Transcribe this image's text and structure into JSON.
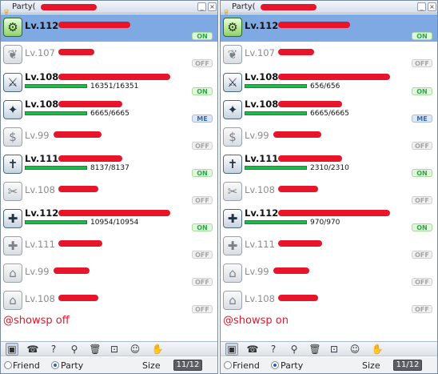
{
  "windows": [
    {
      "title": "Party(",
      "caption": "@showsp off",
      "members": [
        {
          "level": "Lv.112",
          "icon": "mechanic-icon",
          "glyph": "⚙",
          "selected": true,
          "online": true,
          "badge": "ON"
        },
        {
          "level": "Lv.107",
          "icon": "sura-icon",
          "glyph": "❦",
          "online": false,
          "badge": "OFF"
        },
        {
          "level": "Lv.108",
          "icon": "rune-knight-icon",
          "glyph": "⚔",
          "online": true,
          "badge": "ON",
          "hp": "16351/16351",
          "hp_ratio": 1.0
        },
        {
          "level": "Lv.108",
          "icon": "sorcerer-icon",
          "glyph": "✦",
          "online": true,
          "badge": "ME",
          "hp": "6665/6665",
          "hp_ratio": 1.0
        },
        {
          "level": "Lv.99",
          "icon": "merchant-icon",
          "glyph": "$",
          "online": false,
          "badge": "OFF"
        },
        {
          "level": "Lv.111",
          "icon": "arch-bishop-icon",
          "glyph": "✝",
          "online": true,
          "badge": "ON",
          "hp": "8137/8137",
          "hp_ratio": 1.0
        },
        {
          "level": "Lv.108",
          "icon": "guillotine-cross-icon",
          "glyph": "✂",
          "online": false,
          "badge": "OFF"
        },
        {
          "level": "Lv.112",
          "icon": "ranger-icon",
          "glyph": "✚",
          "online": true,
          "badge": "ON",
          "hp": "10954/10954",
          "hp_ratio": 1.0
        },
        {
          "level": "Lv.111",
          "icon": "shadow-chaser-icon",
          "glyph": "✚",
          "online": false,
          "badge": "OFF"
        },
        {
          "level": "Lv.99",
          "icon": "novice-icon",
          "glyph": "⌂",
          "online": false,
          "badge": "OFF"
        },
        {
          "level": "Lv.108",
          "icon": "genetic-icon",
          "glyph": "⌂",
          "online": false,
          "badge": "OFF"
        }
      ],
      "footer": {
        "friend_label": "Friend",
        "party_label": "Party",
        "size_label": "Size",
        "size_value": "11/12"
      }
    },
    {
      "title": "Party(",
      "caption": "@showsp on",
      "members": [
        {
          "level": "Lv.112",
          "icon": "mechanic-icon",
          "glyph": "⚙",
          "selected": true,
          "online": true,
          "badge": "ON"
        },
        {
          "level": "Lv.107",
          "icon": "sura-icon",
          "glyph": "❦",
          "online": false,
          "badge": "OFF"
        },
        {
          "level": "Lv.108",
          "icon": "rune-knight-icon",
          "glyph": "⚔",
          "online": true,
          "badge": "ON",
          "hp": "656/656",
          "hp_ratio": 1.0
        },
        {
          "level": "Lv.108",
          "icon": "sorcerer-icon",
          "glyph": "✦",
          "online": true,
          "badge": "ME",
          "hp": "6665/6665",
          "hp_ratio": 1.0
        },
        {
          "level": "Lv.99",
          "icon": "merchant-icon",
          "glyph": "$",
          "online": false,
          "badge": "OFF"
        },
        {
          "level": "Lv.111",
          "icon": "arch-bishop-icon",
          "glyph": "✝",
          "online": true,
          "badge": "ON",
          "hp": "2310/2310",
          "hp_ratio": 1.0
        },
        {
          "level": "Lv.108",
          "icon": "guillotine-cross-icon",
          "glyph": "✂",
          "online": false,
          "badge": "OFF"
        },
        {
          "level": "Lv.112",
          "icon": "ranger-icon",
          "glyph": "✚",
          "online": true,
          "badge": "ON",
          "hp": "970/970",
          "hp_ratio": 1.0
        },
        {
          "level": "Lv.111",
          "icon": "shadow-chaser-icon",
          "glyph": "✚",
          "online": false,
          "badge": "OFF"
        },
        {
          "level": "Lv.99",
          "icon": "novice-icon",
          "glyph": "⌂",
          "online": false,
          "badge": "OFF"
        },
        {
          "level": "Lv.108",
          "icon": "genetic-icon",
          "glyph": "⌂",
          "online": false,
          "badge": "OFF"
        }
      ],
      "footer": {
        "friend_label": "Friend",
        "party_label": "Party",
        "size_label": "Size",
        "size_value": "11/12"
      }
    }
  ],
  "toolbar": [
    {
      "icon": "party-window-icon",
      "glyph": "▣",
      "pressed": true
    },
    {
      "icon": "chat-bubble-icon",
      "glyph": "☎"
    },
    {
      "icon": "help-icon",
      "glyph": "?"
    },
    {
      "icon": "search-icon",
      "glyph": "⚲"
    },
    {
      "icon": "trash-icon",
      "glyph": "🗑"
    },
    {
      "icon": "lock-icon",
      "glyph": "⊡"
    },
    {
      "icon": "add-member-icon",
      "glyph": "☺+"
    },
    {
      "icon": "party-settings-icon",
      "glyph": "✋"
    }
  ],
  "colors": {
    "redaction": "#e8142a",
    "selected_row": "#7ea9e2",
    "hp_bar": "#1fb84b",
    "online_badge": "#2aa84a",
    "me_badge": "#3c69b0"
  }
}
